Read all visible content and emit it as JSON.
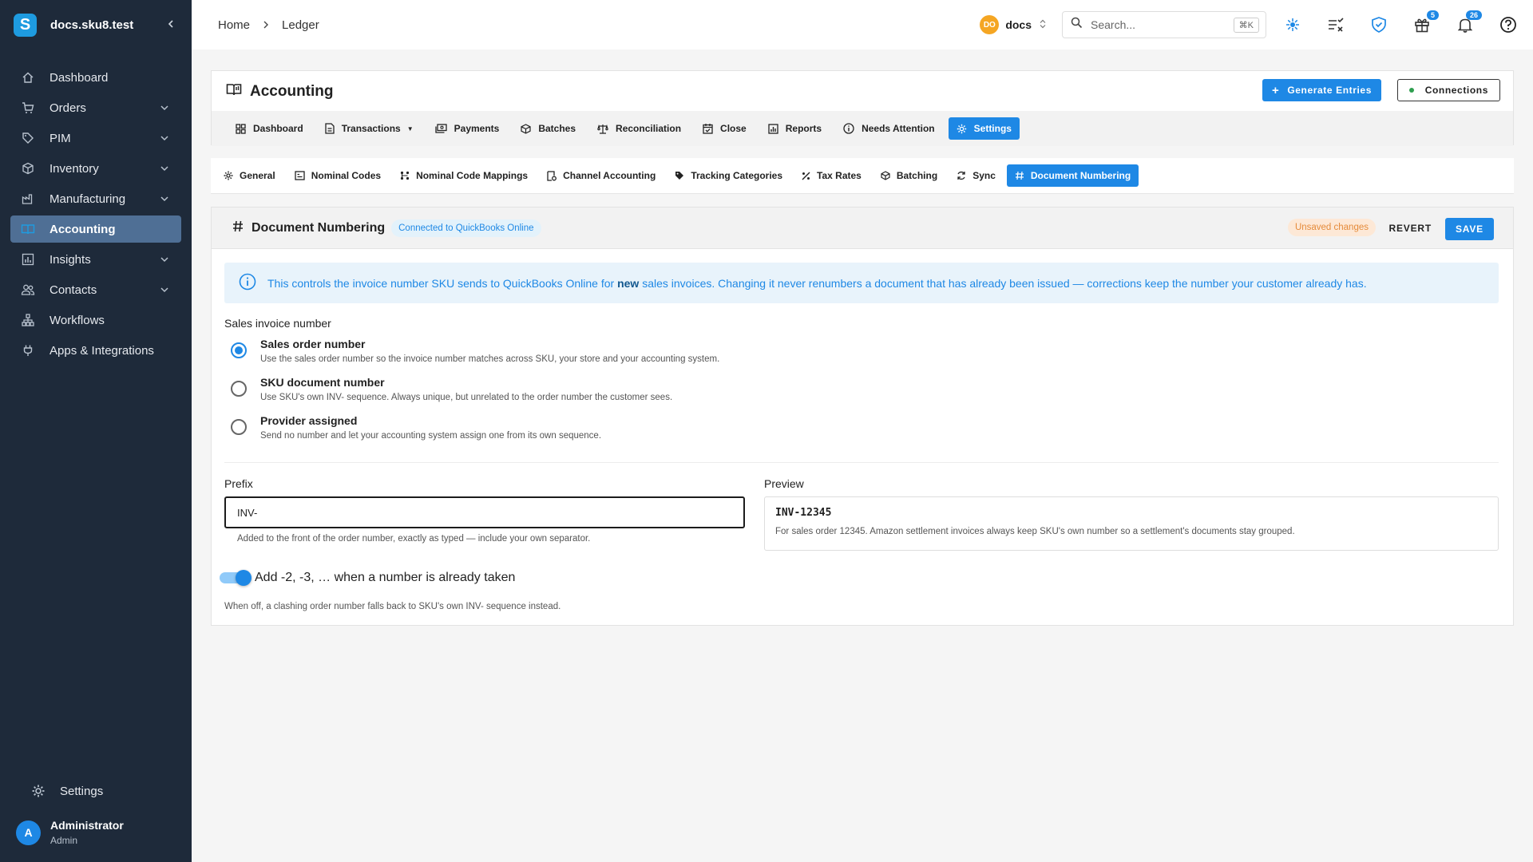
{
  "sidebar": {
    "site_name": "docs.sku8.test",
    "logo_letter": "S",
    "items": [
      {
        "label": "Dashboard",
        "icon": "home-icon",
        "expandable": false
      },
      {
        "label": "Orders",
        "icon": "cart-icon",
        "expandable": true
      },
      {
        "label": "PIM",
        "icon": "tag-icon",
        "expandable": true
      },
      {
        "label": "Inventory",
        "icon": "box-icon",
        "expandable": true
      },
      {
        "label": "Manufacturing",
        "icon": "factory-icon",
        "expandable": true
      },
      {
        "label": "Accounting",
        "icon": "ledger-icon",
        "expandable": false,
        "active": true
      },
      {
        "label": "Insights",
        "icon": "chart-icon",
        "expandable": true
      },
      {
        "label": "Contacts",
        "icon": "people-icon",
        "expandable": true
      },
      {
        "label": "Workflows",
        "icon": "workflow-icon",
        "expandable": false
      },
      {
        "label": "Apps & Integrations",
        "icon": "plug-icon",
        "expandable": false
      }
    ],
    "settings_label": "Settings",
    "user": {
      "initial": "A",
      "name": "Administrator",
      "role": "Admin"
    }
  },
  "topbar": {
    "breadcrumbs": [
      "Home",
      "Ledger"
    ],
    "workspace": {
      "initials": "DO",
      "name": "docs"
    },
    "search": {
      "placeholder": "Search...",
      "shortcut": "⌘K"
    },
    "badges": {
      "gifts": "5",
      "notifications": "26"
    }
  },
  "accounting": {
    "title": "Accounting",
    "generate_label": "Generate Entries",
    "connections_label": "Connections",
    "tabs": [
      {
        "label": "Dashboard",
        "icon": "grid-icon"
      },
      {
        "label": "Transactions",
        "icon": "document-icon",
        "dropdown": true
      },
      {
        "label": "Payments",
        "icon": "payments-icon"
      },
      {
        "label": "Batches",
        "icon": "cube-icon"
      },
      {
        "label": "Reconciliation",
        "icon": "scale-icon"
      },
      {
        "label": "Close",
        "icon": "calendar-check-icon"
      },
      {
        "label": "Reports",
        "icon": "report-icon"
      },
      {
        "label": "Needs Attention",
        "icon": "info-icon"
      },
      {
        "label": "Settings",
        "icon": "gear-icon",
        "active": true
      }
    ]
  },
  "settings_tabs": [
    {
      "label": "General",
      "icon": "gear-icon"
    },
    {
      "label": "Nominal Codes",
      "icon": "list-icon"
    },
    {
      "label": "Nominal Code Mappings",
      "icon": "mapping-icon"
    },
    {
      "label": "Channel Accounting",
      "icon": "channel-icon"
    },
    {
      "label": "Tracking Categories",
      "icon": "tag-icon"
    },
    {
      "label": "Tax Rates",
      "icon": "percent-icon"
    },
    {
      "label": "Batching",
      "icon": "layers-icon"
    },
    {
      "label": "Sync",
      "icon": "sync-icon"
    },
    {
      "label": "Document Numbering",
      "icon": "hash-icon",
      "active": true
    }
  ],
  "panel": {
    "title": "Document Numbering",
    "connection_chip": "Connected to QuickBooks Online",
    "unsaved_label": "Unsaved changes",
    "revert_label": "REVERT",
    "save_label": "SAVE",
    "info": {
      "before": "This controls the invoice number SKU sends to QuickBooks Online for ",
      "bold": "new",
      "after": " sales invoices. Changing it never renumbers a document that has already been issued — corrections keep the number your customer already has."
    },
    "section_label": "Sales invoice number",
    "options": [
      {
        "title": "Sales order number",
        "desc": "Use the sales order number so the invoice number matches across SKU, your store and your accounting system.",
        "selected": true
      },
      {
        "title": "SKU document number",
        "desc": "Use SKU's own INV- sequence. Always unique, but unrelated to the order number the customer sees.",
        "selected": false
      },
      {
        "title": "Provider assigned",
        "desc": "Send no number and let your accounting system assign one from its own sequence.",
        "selected": false
      }
    ],
    "prefix": {
      "label": "Prefix",
      "value": "INV-",
      "helper": "Added to the front of the order number, exactly as typed — include your own separator."
    },
    "preview": {
      "label": "Preview",
      "number": "INV-12345",
      "desc": "For sales order 12345. Amazon settlement invoices always keep SKU's own number so a settlement's documents stay grouped."
    },
    "toggle": {
      "label": "Add -2, -3, … when a number is already taken",
      "on": true,
      "helper": "When off, a clashing order number falls back to SKU's own INV- sequence instead."
    }
  },
  "colors": {
    "sidebar_bg": "#1e2a3a",
    "accent": "#1e88e5",
    "active_nav": "#4f6f95",
    "warning": "#e58b3a",
    "success": "#2e9e4f"
  }
}
